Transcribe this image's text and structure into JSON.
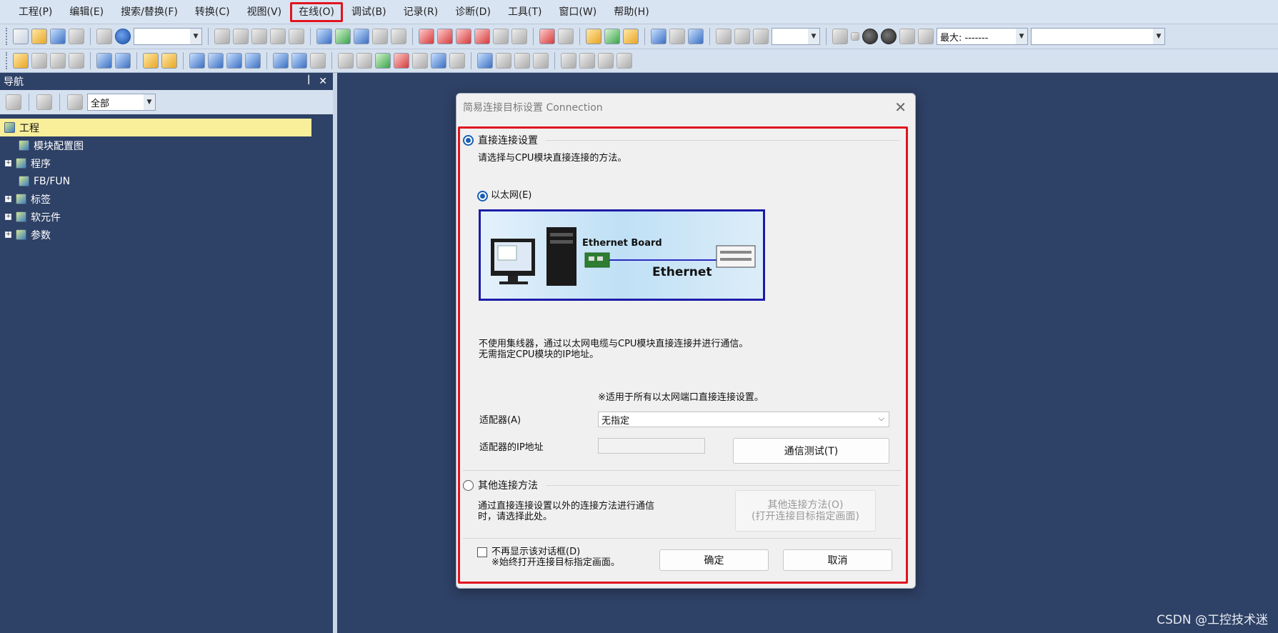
{
  "menu": [
    "工程(P)",
    "编辑(E)",
    "搜索/替换(F)",
    "转换(C)",
    "视图(V)",
    "在线(O)",
    "调试(B)",
    "记录(R)",
    "诊断(D)",
    "工具(T)",
    "窗口(W)",
    "帮助(H)"
  ],
  "toolbar": {
    "zoom_label": "最大: -------"
  },
  "nav": {
    "title": "导航",
    "pin": "ꟾ",
    "close": "✕",
    "filter_value": "全部",
    "tree": [
      {
        "label": "工程",
        "selected": true,
        "expand": ""
      },
      {
        "label": "模块配置图",
        "selected": false,
        "expand": ""
      },
      {
        "label": "程序",
        "selected": false,
        "expand": "+"
      },
      {
        "label": "FB/FUN",
        "selected": false,
        "expand": ""
      },
      {
        "label": "标签",
        "selected": false,
        "expand": "+"
      },
      {
        "label": "软元件",
        "selected": false,
        "expand": "+"
      },
      {
        "label": "参数",
        "selected": false,
        "expand": "+"
      }
    ]
  },
  "dialog": {
    "title": "简易连接目标设置 Connection",
    "direct_label": "直接连接设置",
    "direct_desc": "请选择与CPU模块直接连接的方法。",
    "ethernet_label": "以太网(E)",
    "diagram_board": "Ethernet Board",
    "diagram_net": "Ethernet",
    "info_line1": "不使用集线器，通过以太网电缆与CPU模块直接连接并进行通信。",
    "info_line2": "无需指定CPU模块的IP地址。",
    "note_all_ports": "※适用于所有以太网端口直接连接设置。",
    "adapter_label": "适配器(A)",
    "adapter_value": "无指定",
    "adapter_ip_label": "适配器的IP地址",
    "test_button": "通信测试(T)",
    "other_label": "其他连接方法",
    "other_desc1": "通过直接连接设置以外的连接方法进行通信",
    "other_desc2": "时，请选择此处。",
    "other_button1": "其他连接方法(O)",
    "other_button2": "(打开连接目标指定画面)",
    "no_show_label": "不再显示该对话框(D)",
    "no_show_note": "※始终打开连接目标指定画面。",
    "ok": "确定",
    "cancel": "取消"
  },
  "watermark": "CSDN @工控技术迷"
}
